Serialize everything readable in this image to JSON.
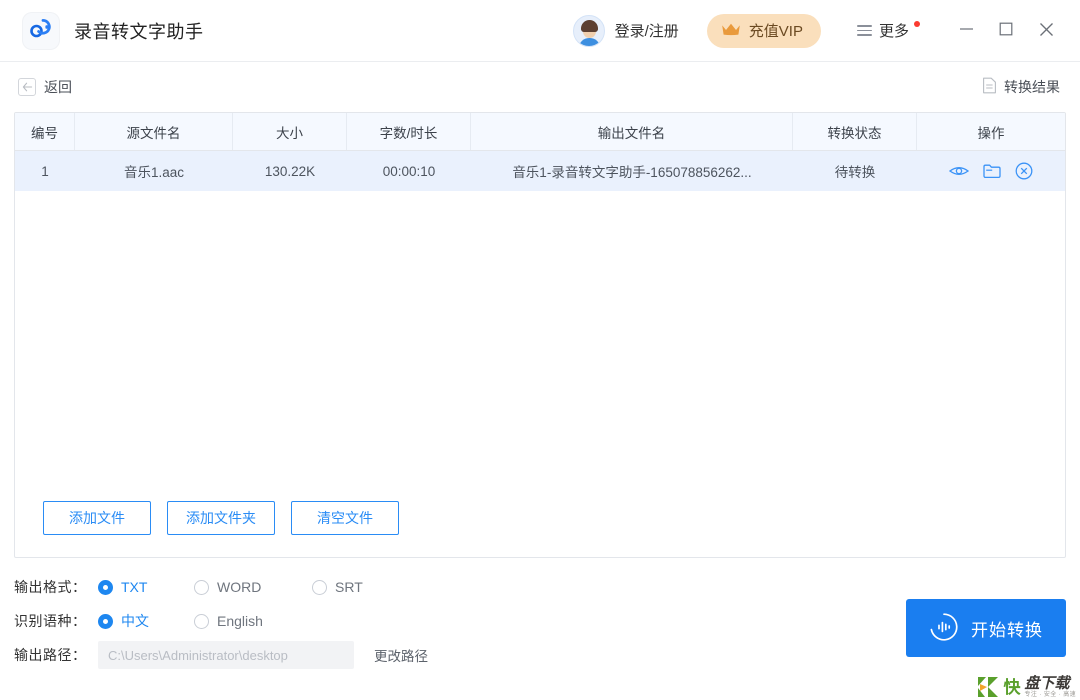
{
  "window": {
    "app_title": "录音转文字助手",
    "logo_icon": "cloud-audio-logo-icon",
    "minimize_glyph": "—",
    "maximize_glyph": "☐",
    "close_glyph": "✕",
    "minimize_name": "minimize-button",
    "maximize_name": "maximize-button",
    "close_name": "close-button"
  },
  "account": {
    "login_label": "登录/注册",
    "avatar_icon": "user-avatar-icon",
    "vip_label": "充值VIP",
    "vip_icon": "crown-icon",
    "vip_bg": "#fadfbc",
    "vip_text_color": "#6b4a22",
    "more_label": "更多",
    "more_icon": "hamburger-menu-icon",
    "more_badge": true,
    "badge_color": "#fb3b30"
  },
  "subbar": {
    "back_label": "返回",
    "back_icon": "arrow-left-icon",
    "result_label": "转换结果",
    "result_icon": "document-icon"
  },
  "table": {
    "columns": [
      {
        "key": "index",
        "label": "编号"
      },
      {
        "key": "source",
        "label": "源文件名"
      },
      {
        "key": "size",
        "label": "大小"
      },
      {
        "key": "dur",
        "label": "字数/时长"
      },
      {
        "key": "output",
        "label": "输出文件名"
      },
      {
        "key": "status",
        "label": "转换状态"
      },
      {
        "key": "ops",
        "label": "操作"
      }
    ],
    "rows": [
      {
        "index": "1",
        "source": "音乐1.aac",
        "size": "130.22K",
        "dur": "00:00:10",
        "output": "音乐1-录音转文字助手-165078856262...",
        "status": "待转换",
        "ops": [
          {
            "name": "preview-icon",
            "title": "预览"
          },
          {
            "name": "folder-icon",
            "title": "打开文件夹"
          },
          {
            "name": "remove-icon",
            "title": "移除"
          }
        ]
      }
    ],
    "header_bg": "#f5f9ff",
    "row_bg": "#eaf1fd",
    "accent": "#2a8cf5"
  },
  "actions": {
    "add_file": "添加文件",
    "add_folder": "添加文件夹",
    "clear_files": "清空文件"
  },
  "settings": {
    "format_label": "输出格式：",
    "format_options": [
      {
        "label": "TXT",
        "selected": true
      },
      {
        "label": "WORD",
        "selected": false
      },
      {
        "label": "SRT",
        "selected": false
      }
    ],
    "language_label": "识别语种：",
    "language_options": [
      {
        "label": "中文",
        "selected": true
      },
      {
        "label": "English",
        "selected": false
      }
    ],
    "path_label": "输出路径：",
    "path_placeholder": "C:\\Users\\Administrator\\desktop",
    "path_value": "",
    "change_path_label": "更改路径"
  },
  "start": {
    "label": "开始转换",
    "icon": "audio-wave-icon",
    "bg": "#1a7ef0"
  },
  "watermark": {
    "mark": "K",
    "word": "快",
    "main": "盘下载",
    "sub": "专注 · 安全 · 高速"
  }
}
